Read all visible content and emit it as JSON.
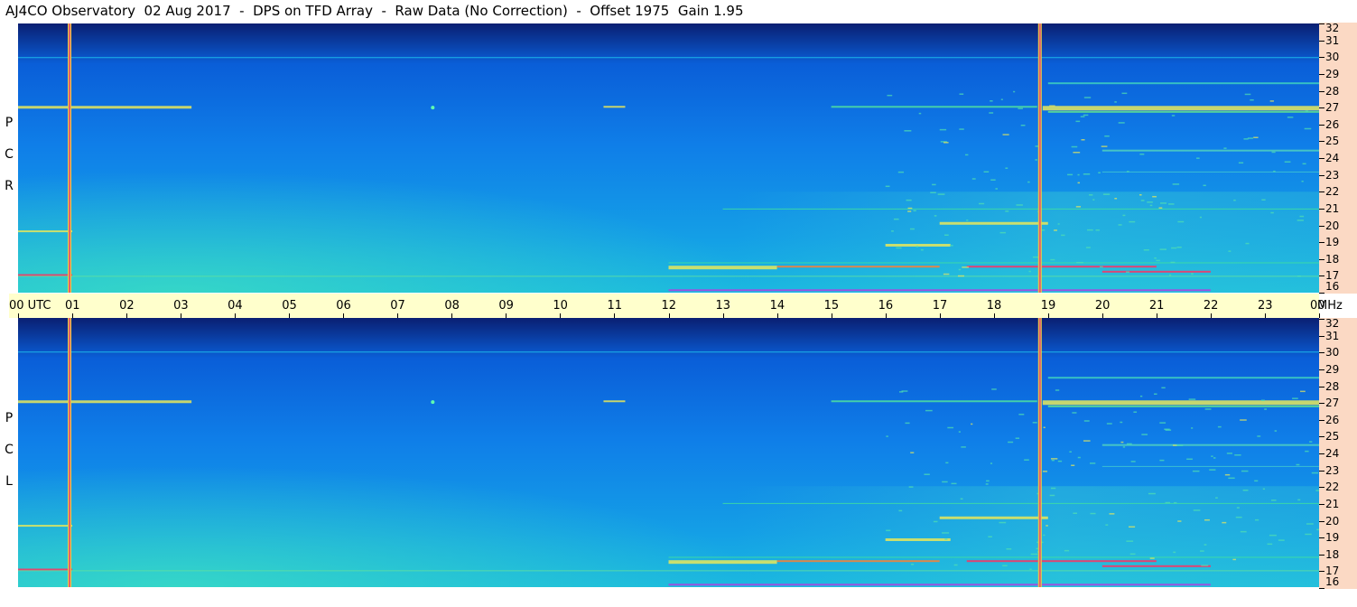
{
  "title": "AJ4CO Observatory  02 Aug 2017  -  DPS on TFD Array  -  Raw Data (No Correction)  -  Offset 1975  Gain 1.95",
  "chart_data": {
    "type": "heatmap",
    "panels": [
      {
        "name": "R C P",
        "letters": [
          "R",
          "C",
          "P"
        ]
      },
      {
        "name": "L C P",
        "letters": [
          "L",
          "C",
          "P"
        ]
      }
    ],
    "x_axis": {
      "labels": [
        "00 UTC",
        "01",
        "02",
        "03",
        "04",
        "05",
        "06",
        "07",
        "08",
        "09",
        "10",
        "11",
        "12",
        "13",
        "14",
        "15",
        "16",
        "17",
        "18",
        "19",
        "20",
        "21",
        "22",
        "23",
        "00"
      ],
      "range_hours": [
        0,
        24
      ]
    },
    "y_axis": {
      "unit": "MHz",
      "labels": [
        "32",
        "31",
        "30",
        "29",
        "28",
        "27",
        "26",
        "25",
        "24",
        "23",
        "22",
        "21",
        "20",
        "19",
        "18",
        "17",
        "16"
      ],
      "range_mhz": [
        16,
        32
      ]
    },
    "vertical_markers_hours": [
      0.95,
      18.85
    ],
    "colors": {
      "high": "#0a1f72",
      "mid": "#0f7ee8",
      "low": "#1ab8e0",
      "hot": "#e8e85a",
      "peak": "#ff3060",
      "marker": "#e06070",
      "axis_bg": "#ffffcc",
      "freq_bg": "#fbd9c4"
    }
  }
}
